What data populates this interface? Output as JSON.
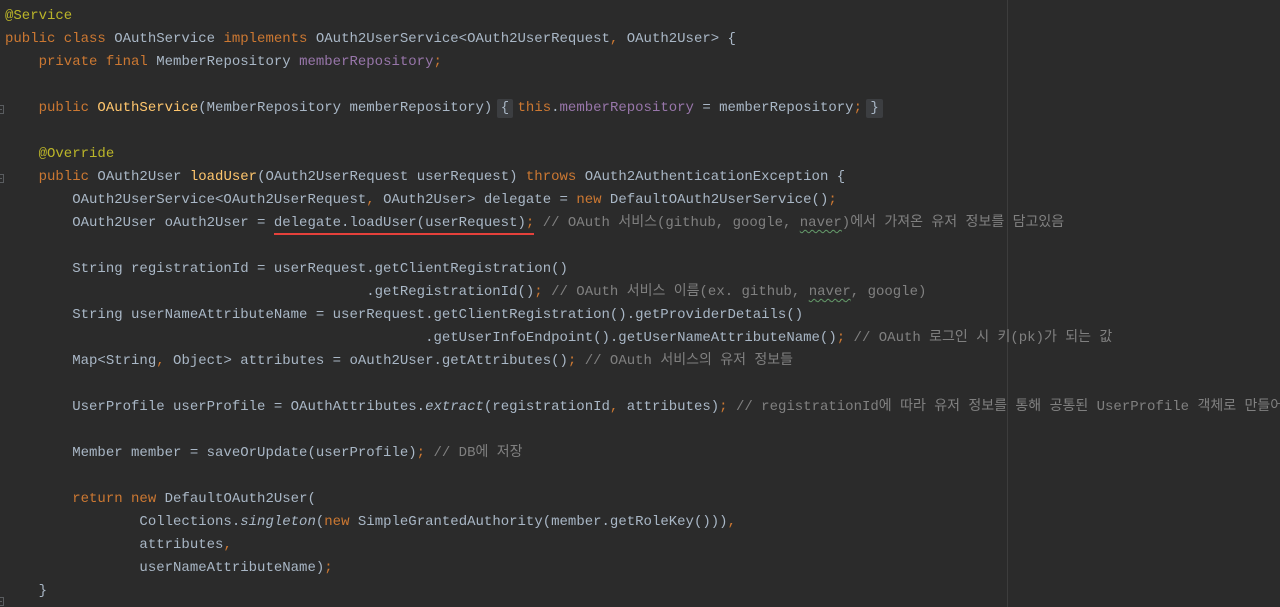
{
  "editor": {
    "theme": {
      "background": "#2B2B2B",
      "text": "#A9B7C6",
      "margin_guide": "#3D3D3D",
      "fold_background": "#3C3E41",
      "highlight_underline": "#E5413B",
      "typo_underline": "#659C6B",
      "gutter_icon": "#5A5D60"
    },
    "lines": [
      {
        "tokens": [
          {
            "v": "@Service",
            "c": "#BBB529"
          }
        ]
      },
      {
        "tokens": [
          {
            "v": "public class ",
            "c": "#CC7832"
          },
          {
            "v": "OAuthService "
          },
          {
            "v": "implements ",
            "c": "#CC7832"
          },
          {
            "v": "OAuth2UserService<OAuth2UserRequest"
          },
          {
            "v": ", ",
            "c": "#CC7832"
          },
          {
            "v": "OAuth2User> {"
          }
        ]
      },
      {
        "tokens": [
          {
            "v": "    private final ",
            "c": "#CC7832"
          },
          {
            "v": "MemberRepository "
          },
          {
            "v": "memberRepository",
            "c": "#9876AA"
          },
          {
            "v": ";",
            "c": "#CC7832"
          }
        ]
      },
      {
        "tokens": []
      },
      {
        "tokens": [
          {
            "v": "    public ",
            "c": "#CC7832"
          },
          {
            "v": "OAuthService",
            "c": "#FFC66D"
          },
          {
            "v": "(MemberRepository memberRepository) "
          },
          {
            "v": "{",
            "f": true
          },
          {
            "v": " this",
            "c": "#CC7832"
          },
          {
            "v": "."
          },
          {
            "v": "memberRepository",
            "c": "#9876AA"
          },
          {
            "v": " = memberRepository"
          },
          {
            "v": "; ",
            "c": "#CC7832"
          },
          {
            "v": "}",
            "f": true
          }
        ]
      },
      {
        "tokens": []
      },
      {
        "tokens": [
          {
            "v": "    @Override",
            "c": "#BBB529"
          }
        ]
      },
      {
        "tokens": [
          {
            "v": "    public ",
            "c": "#CC7832"
          },
          {
            "v": "OAuth2User "
          },
          {
            "v": "loadUser",
            "c": "#FFC66D"
          },
          {
            "v": "(OAuth2UserRequest userRequest) "
          },
          {
            "v": "throws ",
            "c": "#CC7832"
          },
          {
            "v": "OAuth2AuthenticationException {"
          }
        ]
      },
      {
        "tokens": [
          {
            "v": "        OAuth2UserService<OAuth2UserRequest"
          },
          {
            "v": ", ",
            "c": "#CC7832"
          },
          {
            "v": "OAuth2User> delegate = "
          },
          {
            "v": "new ",
            "c": "#CC7832"
          },
          {
            "v": "DefaultOAuth2UserService()"
          },
          {
            "v": ";",
            "c": "#CC7832"
          }
        ]
      },
      {
        "tokens": [
          {
            "v": "        OAuth2User oAuth2User = "
          },
          {
            "v": "delegate.loadUser(userRequest)",
            "u": true
          },
          {
            "v": ";",
            "c": "#CC7832",
            "u": true
          },
          {
            "v": " // OAuth 서비스(github, google, ",
            "c": "#808080"
          },
          {
            "v": "naver",
            "c": "#808080",
            "w": true
          },
          {
            "v": ")에서 가져온 유저 정보를 담고있음",
            "c": "#808080"
          }
        ]
      },
      {
        "tokens": []
      },
      {
        "tokens": [
          {
            "v": "        String registrationId = userRequest.getClientRegistration()"
          }
        ]
      },
      {
        "tokens": [
          {
            "v": "                                           .getRegistrationId()"
          },
          {
            "v": ";",
            "c": "#CC7832"
          },
          {
            "v": " // OAuth 서비스 이름(ex. github, ",
            "c": "#808080"
          },
          {
            "v": "naver",
            "c": "#808080",
            "w": true
          },
          {
            "v": ", google)",
            "c": "#808080"
          }
        ]
      },
      {
        "tokens": [
          {
            "v": "        String userNameAttributeName = userRequest.getClientRegistration().getProviderDetails()"
          }
        ]
      },
      {
        "tokens": [
          {
            "v": "                                                  .getUserInfoEndpoint().getUserNameAttributeName()"
          },
          {
            "v": ";",
            "c": "#CC7832"
          },
          {
            "v": " // OAuth 로그인 시 키(pk)가 되는 값",
            "c": "#808080"
          }
        ]
      },
      {
        "tokens": [
          {
            "v": "        Map<String"
          },
          {
            "v": ", ",
            "c": "#CC7832"
          },
          {
            "v": "Object> attributes = oAuth2User.getAttributes()"
          },
          {
            "v": ";",
            "c": "#CC7832"
          },
          {
            "v": " // OAuth 서비스의 유저 정보들",
            "c": "#808080"
          }
        ]
      },
      {
        "tokens": []
      },
      {
        "tokens": [
          {
            "v": "        UserProfile userProfile = OAuthAttributes."
          },
          {
            "v": "extract",
            "i": true
          },
          {
            "v": "(registrationId"
          },
          {
            "v": ", ",
            "c": "#CC7832"
          },
          {
            "v": "attributes)"
          },
          {
            "v": ";",
            "c": "#CC7832"
          },
          {
            "v": " // registrationId에 따라 유저 정보를 통해 공통된 UserProfile 객체로 만들어 줌",
            "c": "#808080"
          }
        ]
      },
      {
        "tokens": []
      },
      {
        "tokens": [
          {
            "v": "        Member member = saveOrUpdate(userProfile)"
          },
          {
            "v": ";",
            "c": "#CC7832"
          },
          {
            "v": " // DB에 저장",
            "c": "#808080"
          }
        ]
      },
      {
        "tokens": []
      },
      {
        "tokens": [
          {
            "v": "        return new ",
            "c": "#CC7832"
          },
          {
            "v": "DefaultOAuth2User("
          }
        ]
      },
      {
        "tokens": [
          {
            "v": "                Collections."
          },
          {
            "v": "singleton",
            "i": true
          },
          {
            "v": "("
          },
          {
            "v": "new ",
            "c": "#CC7832"
          },
          {
            "v": "SimpleGrantedAuthority(member.getRoleKey()))"
          },
          {
            "v": ",",
            "c": "#CC7832"
          }
        ]
      },
      {
        "tokens": [
          {
            "v": "                attributes"
          },
          {
            "v": ",",
            "c": "#CC7832"
          }
        ]
      },
      {
        "tokens": [
          {
            "v": "                userNameAttributeName)"
          },
          {
            "v": ";",
            "c": "#CC7832"
          }
        ]
      },
      {
        "tokens": [
          {
            "v": "    }"
          }
        ]
      }
    ]
  }
}
